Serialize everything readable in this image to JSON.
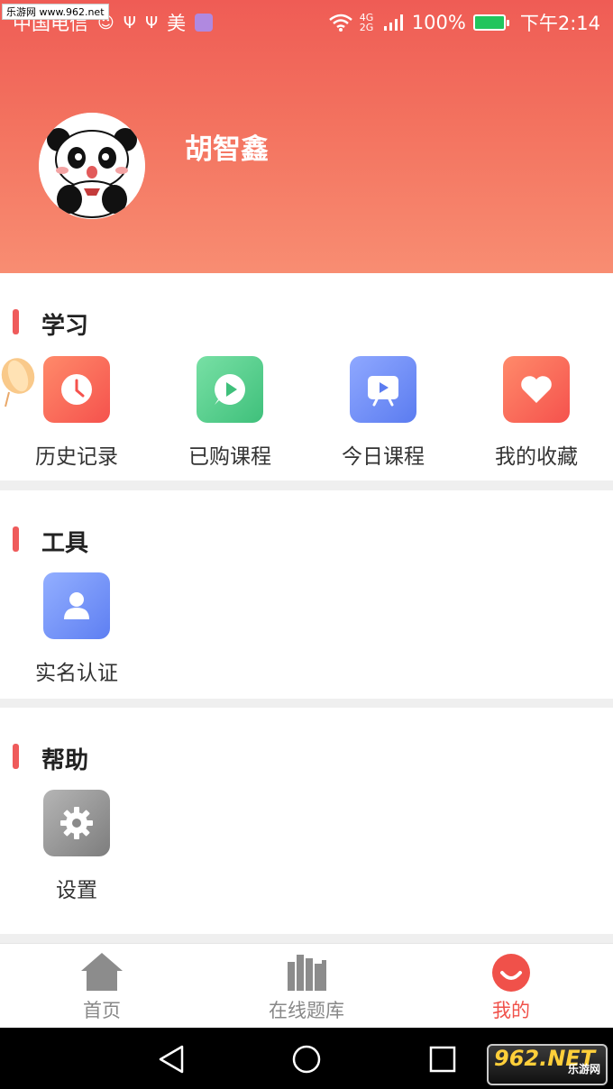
{
  "status_bar": {
    "carrier": "中国电信",
    "icon_label_mei": "美",
    "network": "4G 2G",
    "battery": "100%",
    "time": "下午2:14"
  },
  "watermarks": {
    "top": "乐游网 www.962.net",
    "bottom_main": "962.NET",
    "bottom_sub": "乐游网"
  },
  "profile": {
    "name": "胡智鑫"
  },
  "sections": {
    "study": {
      "title": "学习",
      "items": [
        {
          "label": "历史记录",
          "icon": "clock-icon"
        },
        {
          "label": "已购课程",
          "icon": "play-bubble-icon"
        },
        {
          "label": "今日课程",
          "icon": "tv-play-icon"
        },
        {
          "label": "我的收藏",
          "icon": "heart-icon"
        }
      ]
    },
    "tools": {
      "title": "工具",
      "items": [
        {
          "label": "实名认证",
          "icon": "person-icon"
        }
      ]
    },
    "help": {
      "title": "帮助",
      "items": [
        {
          "label": "设置",
          "icon": "gear-icon"
        }
      ]
    }
  },
  "tabbar": {
    "tabs": [
      {
        "label": "首页",
        "icon": "home-icon",
        "active": false
      },
      {
        "label": "在线题库",
        "icon": "books-icon",
        "active": false
      },
      {
        "label": "我的",
        "icon": "profile-face-icon",
        "active": true
      }
    ],
    "active_color": "#f0514a",
    "inactive_color": "#888888"
  },
  "colors": {
    "header_top": "#ef5c55",
    "header_bottom": "#f88d72",
    "accent_bar": "#ef5b5b"
  }
}
